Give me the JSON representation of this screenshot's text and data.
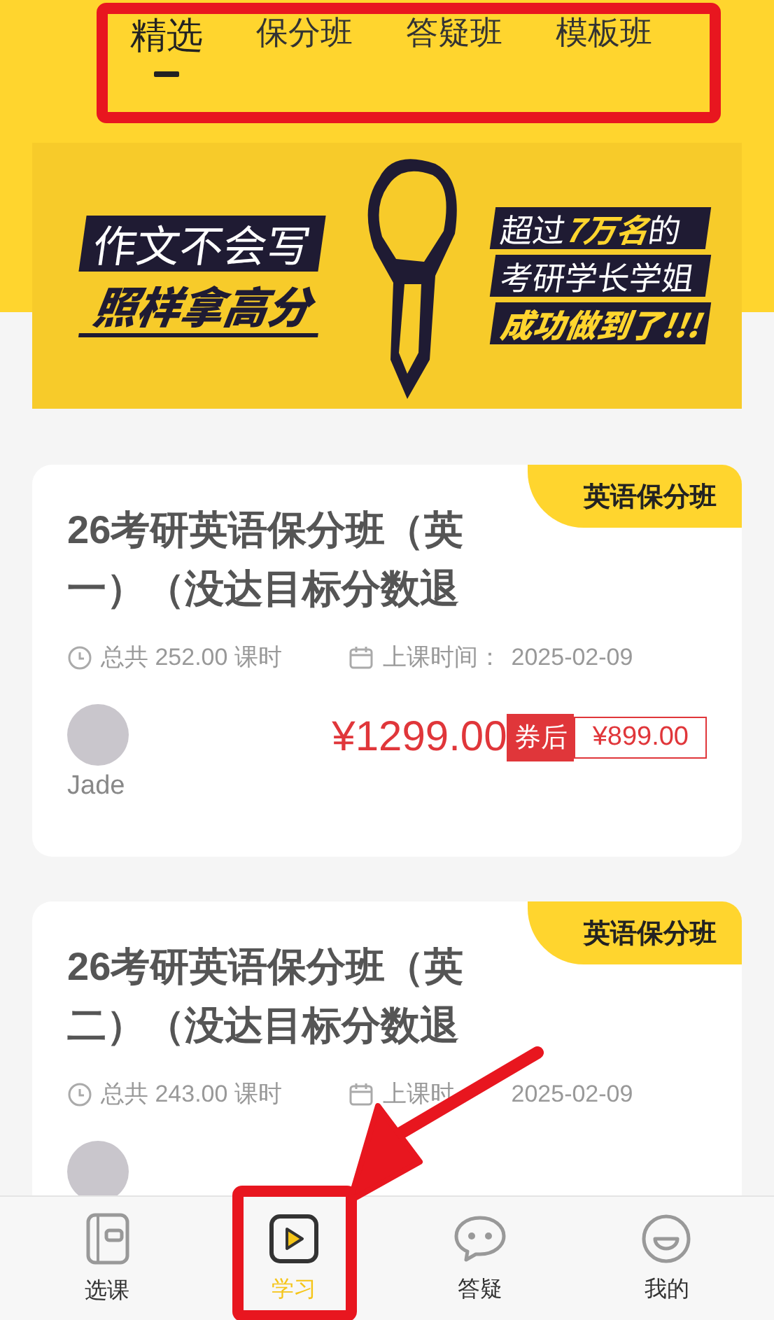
{
  "tabs": [
    {
      "label": "精选",
      "selected": true
    },
    {
      "label": "保分班",
      "selected": false
    },
    {
      "label": "答疑班",
      "selected": false
    },
    {
      "label": "模板班",
      "selected": false
    }
  ],
  "banner": {
    "left_lines": [
      {
        "text": "作文不会写",
        "bold": false
      },
      {
        "text": "照样拿高分",
        "bold": true
      }
    ],
    "right_lines": [
      {
        "text": "超过**7万名**的",
        "bold": false
      },
      {
        "text": "考研学长学姐",
        "bold": false
      },
      {
        "text": "成功做到了!!!",
        "bold": true
      }
    ]
  },
  "courses": [
    {
      "badge": "英语保分班",
      "title": "26考研英语保分班（英一）（没达目标分数退",
      "hours": "总共 252.00 课时",
      "start_label": "上课时间：",
      "start": "2025-02-09",
      "teacher": "Jade",
      "price": "¥1299.00",
      "coupon_label": "券后",
      "coupon_price": "¥899.00"
    },
    {
      "badge": "英语保分班",
      "title": "26考研英语保分班（英二）（没达目标分数退",
      "hours": "总共 243.00 课时",
      "start_label": "上课时",
      "start": "2025-02-09"
    }
  ],
  "bottom_nav": [
    {
      "label": "选课",
      "kind": "book",
      "selected": false
    },
    {
      "label": "学习",
      "kind": "play",
      "selected": true
    },
    {
      "label": "答疑",
      "kind": "chat",
      "selected": false
    },
    {
      "label": "我的",
      "kind": "smile",
      "selected": false
    }
  ]
}
